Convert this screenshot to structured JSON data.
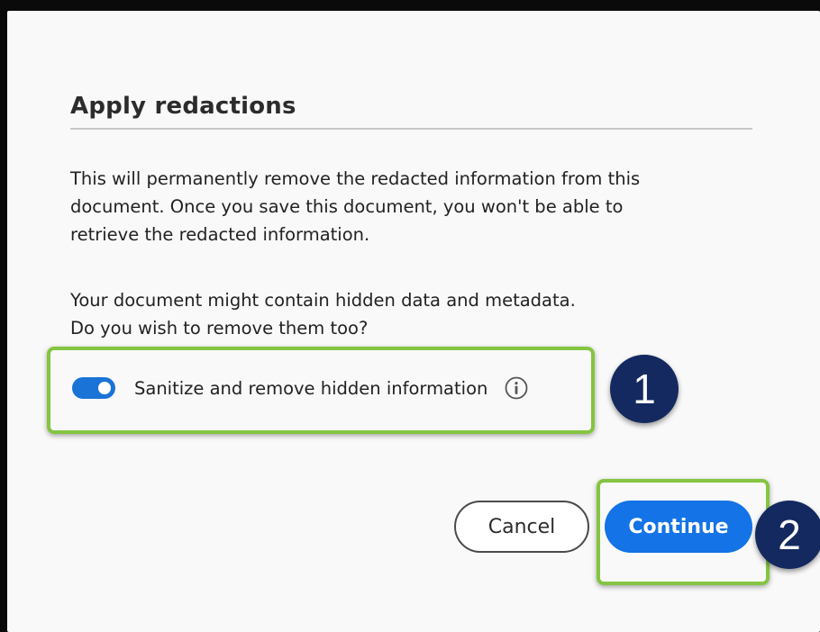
{
  "dialog": {
    "title": "Apply redactions",
    "paragraph1_lines": [
      "This will permanently remove the redacted information from this",
      "document. Once you save this document, you won't be able to",
      "retrieve the redacted information."
    ],
    "paragraph2_lines": [
      "Your document might contain hidden data and metadata.",
      "Do you wish to remove them too?"
    ],
    "sanitize_toggle": {
      "label": "Sanitize and remove hidden information",
      "checked": true,
      "info_icon": "info-icon"
    },
    "buttons": {
      "cancel_label": "Cancel",
      "continue_label": "Continue"
    }
  },
  "annotations": {
    "badge1": "1",
    "badge2": "2",
    "highlight_color": "#84c541",
    "badge_color": "#13295f"
  },
  "colors": {
    "accent": "#1473e6",
    "toggle_on": "#1a73d6",
    "background": "#f9f9f9"
  }
}
